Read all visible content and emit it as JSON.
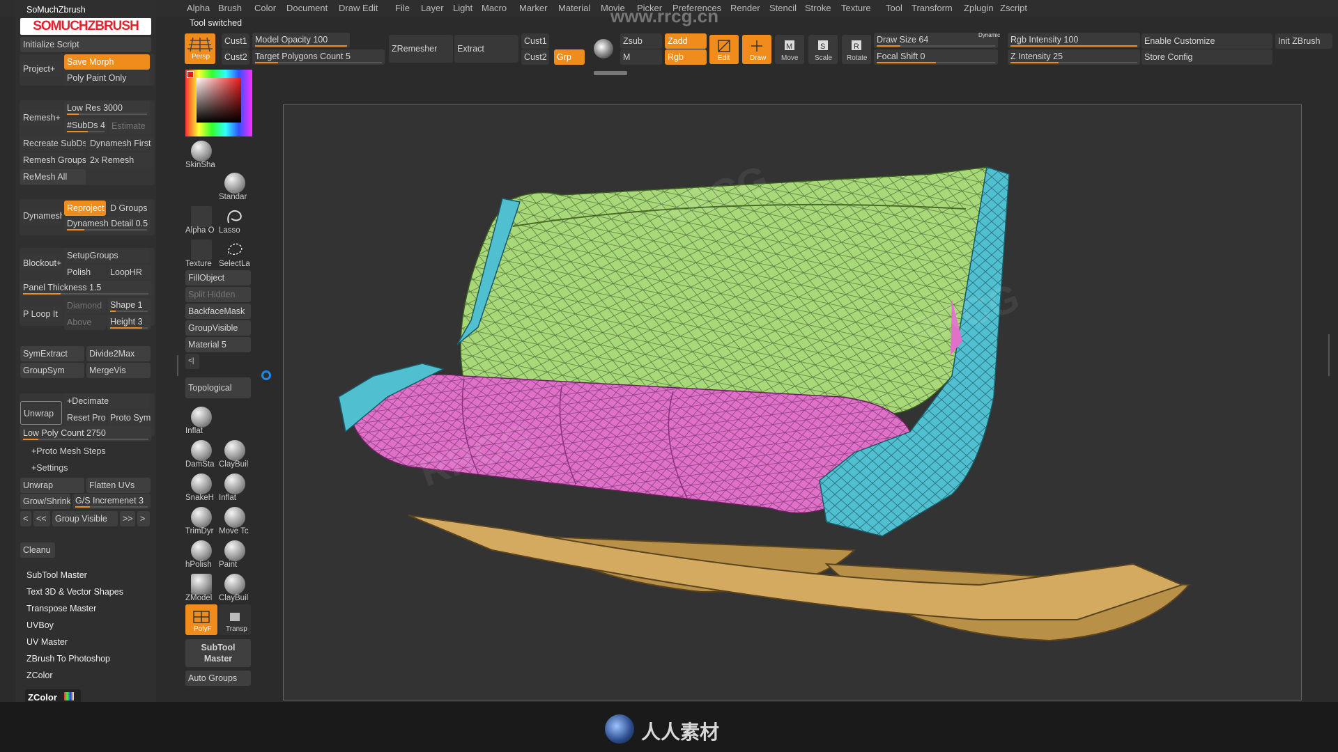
{
  "menus": [
    "Alpha",
    "Brush",
    "Color",
    "Document",
    "Draw",
    "Edit",
    "File",
    "Layer",
    "Light",
    "Macro",
    "Marker",
    "Material",
    "Movie",
    "Picker",
    "Preferences",
    "Render",
    "Stencil",
    "Stroke",
    "Texture",
    "Tool",
    "Transform",
    "Zplugin",
    "Zscript"
  ],
  "status": "Tool switched",
  "watermark_url": "www.rrcg.cn",
  "plugin_title": "SoMuchZbrush",
  "plugin_logo": "SOMUCHZBRUSH",
  "left": {
    "initialize_script": "Initialize Script",
    "project": "Project+",
    "save_morph": "Save Morph",
    "poly_paint_only": "Poly Paint Only",
    "remesh": "Remesh+",
    "low_res": "Low Res 3000",
    "subds": "#SubDs 4",
    "estimate": "Estimate",
    "recreate_subds": "Recreate SubDs",
    "dynamesh_first": "Dynamesh First",
    "remesh_groups": "Remesh Groups",
    "x2_remesh": "2x Remesh",
    "remesh_all": "ReMesh All",
    "dynamesh": "Dynamesh",
    "reproject": "Reproject",
    "d_groups": "D Groups",
    "dynamesh_detail": "Dynamesh Detail 0.5",
    "blockout": "Blockout+",
    "setup_groups": "SetupGroups",
    "polish": "Polish",
    "loophr": "LoopHR",
    "panel_thickness": "Panel Thickness 1.5",
    "p_loop_it": "P Loop It",
    "diamond": "Diamond",
    "shape": "Shape 1",
    "above": "Above",
    "height": "Height 3",
    "symextract": "SymExtract",
    "divide2max": "Divide2Max",
    "groupsym": "GroupSym",
    "mergevis": "MergeVis",
    "unwrap": "Unwrap",
    "decimate": "+Decimate",
    "reset_prot": "Reset Prot",
    "proto_sym": "Proto Sym",
    "low_poly_count": "Low Poly Count 2750",
    "proto_mesh_steps": "+Proto Mesh Steps",
    "settings": "+Settings",
    "unwrap2": "Unwrap",
    "flatten_uvs": "Flatten UVs",
    "grow_shrink": "Grow/Shrink",
    "gs_increment": "G/S Incremenet 3",
    "prev": "<",
    "prev2": "<<",
    "group_visible": "Group Visible",
    "next2": ">>",
    "next": ">",
    "cleanup": "Cleanu",
    "plugins": [
      "SubTool Master",
      "Text 3D & Vector Shapes",
      "Transpose Master",
      "UVBoy",
      "UV Master",
      "ZBrush To Photoshop",
      "ZColor"
    ],
    "zcolor": "ZColor"
  },
  "top": {
    "persp": "Persp",
    "cust1": "Cust1",
    "cust2": "Cust2",
    "model_opacity": "Model Opacity 100",
    "target_polygons": "Target Polygons Count 5",
    "zremesher": "ZRemesher",
    "extract": "Extract",
    "cust1b": "Cust1",
    "cust2b": "Cust2",
    "grp": "Grp",
    "zsub": "Zsub",
    "m": "M",
    "zadd": "Zadd",
    "rgb": "Rgb",
    "edit": "Edit",
    "draw": "Draw",
    "move": "Move",
    "scale": "Scale",
    "rotate": "Rotate",
    "draw_size": "Draw Size 64",
    "dynamic": "Dynamic",
    "focal_shift": "Focal Shift 0",
    "rgb_intensity": "Rgb Intensity 100",
    "z_intensity": "Z Intensity 25",
    "enable_customize": "Enable Customize",
    "store_config": "Store Config",
    "init_zbrush": "Init ZBrush"
  },
  "tools": {
    "skinshade": "SkinSha",
    "standard": "Standar",
    "alpha": "Alpha O",
    "lasso": "Lasso",
    "texture": "Texture",
    "selectlasso": "SelectLa",
    "fillobject": "FillObject",
    "split_hidden": "Split Hidden",
    "backfacemask": "BackfaceMask",
    "groupvisible": "GroupVisible",
    "material": "Material 5",
    "collapse": "<|",
    "topological": "Topological",
    "brushes": [
      "Inflat",
      "DamSta",
      "ClayBuil",
      "SnakeH",
      "Inflat",
      "TrimDyr",
      "Move Tc",
      "hPolish",
      "Paint",
      "ZModel",
      "ClayBuil"
    ],
    "polyf": "PolyF",
    "transp": "Transp",
    "subtool_master": "SubTool Master",
    "auto_groups": "Auto Groups"
  },
  "footer_brand": "人人素材",
  "colors": {
    "accent": "#f08c1c",
    "seat_cushion": "#e070c8",
    "back_cushion": "#a8d878",
    "frame": "#50c0d0",
    "base": "#c8a058"
  }
}
